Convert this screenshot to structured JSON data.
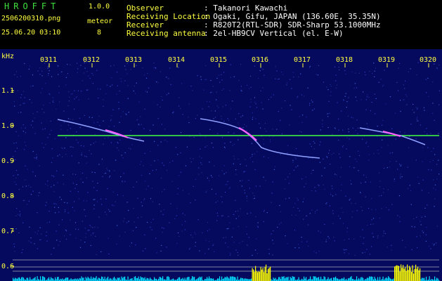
{
  "header": {
    "logo": "HROFFT",
    "version": "1.0.0",
    "filename": "2506200310.png",
    "datetime": "25.06.20 03:10",
    "meteor_label": "meteor",
    "meteor_count": "8"
  },
  "info": [
    {
      "key": "Observer",
      "value": ": Takanori Kawachi"
    },
    {
      "key": "Receiving Location",
      "value": ": Ogaki, Gifu, JAPAN (136.60E, 35.35N)"
    },
    {
      "key": "Receiver",
      "value": ": R820T2(RTL-SDR) SDR-Sharp 53.1000MHz"
    },
    {
      "key": "Receiving antenna",
      "value": ": 2el-HB9CV Vertical (el. E-W)"
    }
  ],
  "axis": {
    "unit": "kHz",
    "time_labels": [
      "0311",
      "0312",
      "0313",
      "0314",
      "0315",
      "0316",
      "0317",
      "0318",
      "0319",
      "0320"
    ],
    "freq_labels": [
      "1.1",
      "1.0",
      "0.9",
      "0.8",
      "0.7",
      "0.6"
    ]
  },
  "colors": {
    "background": "#060a5e",
    "carrier": "#40ff40",
    "echo": "#ff60ff",
    "signal_bars": "#00e0ff",
    "meteor_bars": "#ffff00",
    "text_green": "#3fe03f",
    "text_yellow": "#ffff40"
  }
}
